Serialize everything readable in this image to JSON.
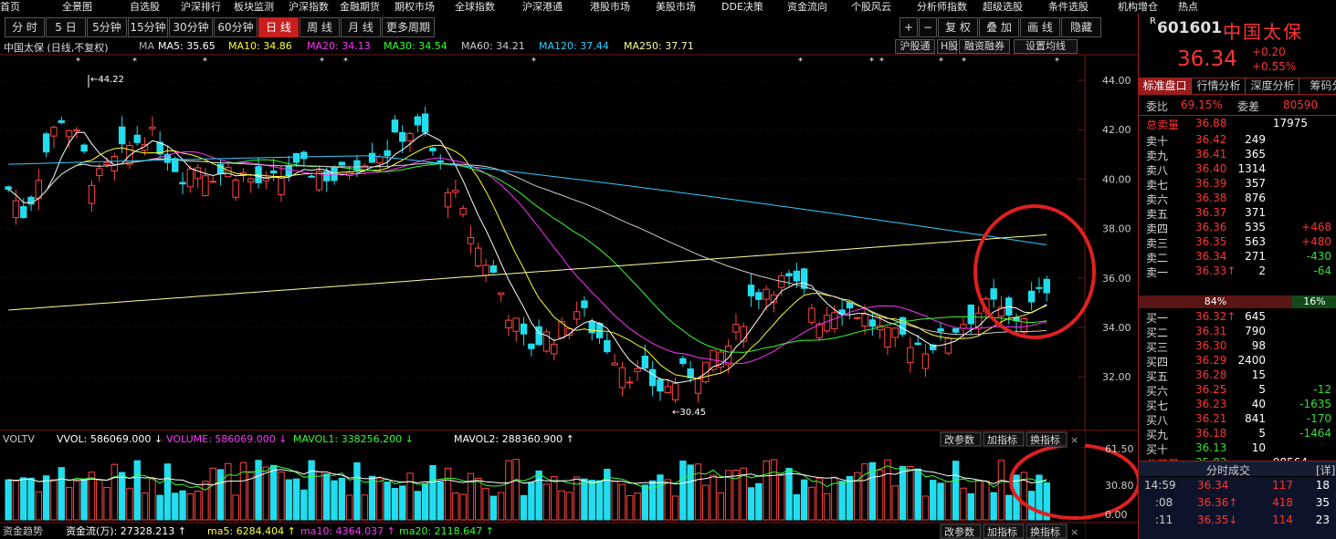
{
  "menu": [
    "首页",
    "全景图",
    "自选股",
    "沪深排行",
    "板块监测",
    "沪深指数",
    "金融期货",
    "期权市场",
    "全球指数",
    "沪深港通",
    "港股市场",
    "美股市场",
    "DDE决策",
    "资金流向",
    "个股风云",
    "分析师指数",
    "超级选股",
    "条件选股",
    "机构增仓",
    "热点"
  ],
  "toolbar": {
    "periods": [
      "分 时",
      "5 日",
      "5分钟",
      "15分钟",
      "30分钟",
      "60分钟",
      "日 线",
      "周 线",
      "月 线",
      "更多周期"
    ],
    "active_period": "日 线",
    "right_buttons": [
      "+",
      "−",
      "复 权",
      "叠 加",
      "画 线",
      "隐藏"
    ]
  },
  "main_legend": {
    "title": "中国太保 (日线,不复权)",
    "ma_label": "MA",
    "items": [
      {
        "label": "MA5: 35.65",
        "color": "#ffffff"
      },
      {
        "label": "MA10: 34.86",
        "color": "#ffff33"
      },
      {
        "label": "MA20: 34.13",
        "color": "#ff33ff"
      },
      {
        "label": "MA30: 34.54",
        "color": "#33ff33"
      },
      {
        "label": "MA60: 34.21",
        "color": "#cccccc"
      },
      {
        "label": "MA120: 37.44",
        "color": "#33ccff"
      },
      {
        "label": "MA250: 37.71",
        "color": "#ffff99"
      }
    ],
    "buttons": [
      "沪股通",
      "H股",
      "融资融券",
      "设置均线"
    ]
  },
  "price_axis": [
    "44.00",
    "42.00",
    "40.00",
    "38.00",
    "36.00",
    "34.00",
    "32.00"
  ],
  "annotations": {
    "high": "44.22",
    "low": "30.45"
  },
  "vol_legend": {
    "name": "VOLTV",
    "items": [
      {
        "label": "VVOL: 586069.000",
        "color": "#ffffff"
      },
      {
        "label": "VOLUME: 586069.000",
        "color": "#ff33ff"
      },
      {
        "label": "MAVOL1: 338256.200",
        "color": "#33ff33"
      },
      {
        "label": "MAVOL2: 288360.900",
        "color": "#ffffff"
      }
    ],
    "buttons": [
      "改参数",
      "加指标",
      "换指标"
    ],
    "axis": [
      "61.50",
      "30.80",
      "0.00"
    ]
  },
  "fund_legend": {
    "name": "资金趋势",
    "items": [
      {
        "label": "资金流(万): 27328.213",
        "color": "#ffffff"
      },
      {
        "label": "ma5: 6284.404",
        "color": "#ffff33"
      },
      {
        "label": "ma10: 4364.037",
        "color": "#ff33ff"
      },
      {
        "label": "ma20: 2118.647",
        "color": "#33ff33"
      }
    ],
    "buttons": [
      "改参数",
      "加指标",
      "换指标"
    ]
  },
  "stock": {
    "code": "601601",
    "name": "中国太保",
    "price": "36.34",
    "change": "+0.20",
    "change_pct": "+0.55%"
  },
  "rtabs": [
    "标准盘口",
    "行情分析",
    "深度分析",
    "筹码分"
  ],
  "weibi": {
    "label": "委比",
    "value": "69.15%",
    "diff_label": "委差",
    "diff": "80590"
  },
  "sell_total": {
    "label": "总卖量",
    "price": "36.88",
    "vol": "17975"
  },
  "asks": [
    {
      "label": "卖十",
      "price": "36.42",
      "vol": "249",
      "chg": ""
    },
    {
      "label": "卖九",
      "price": "36.41",
      "vol": "365",
      "chg": ""
    },
    {
      "label": "卖八",
      "price": "36.40",
      "vol": "1314",
      "chg": ""
    },
    {
      "label": "卖七",
      "price": "36.39",
      "vol": "357",
      "chg": ""
    },
    {
      "label": "卖六",
      "price": "36.38",
      "vol": "876",
      "chg": ""
    },
    {
      "label": "卖五",
      "price": "36.37",
      "vol": "371",
      "chg": ""
    },
    {
      "label": "卖四",
      "price": "36.36",
      "vol": "535",
      "chg": "+468"
    },
    {
      "label": "卖三",
      "price": "36.35",
      "vol": "563",
      "chg": "+480"
    },
    {
      "label": "卖二",
      "price": "36.34",
      "vol": "271",
      "chg": "-430"
    },
    {
      "label": "卖一",
      "price": "36.33↑",
      "vol": "2",
      "chg": "-64"
    }
  ],
  "ratio": {
    "left": "84%",
    "right": "16%"
  },
  "bids": [
    {
      "label": "买一",
      "price": "36.32↑",
      "vol": "645",
      "chg": ""
    },
    {
      "label": "买二",
      "price": "36.31",
      "vol": "790",
      "chg": ""
    },
    {
      "label": "买三",
      "price": "36.30",
      "vol": "98",
      "chg": ""
    },
    {
      "label": "买四",
      "price": "36.29",
      "vol": "2400",
      "chg": ""
    },
    {
      "label": "买五",
      "price": "36.28",
      "vol": "15",
      "chg": ""
    },
    {
      "label": "买六",
      "price": "36.25",
      "vol": "5",
      "chg": "-12"
    },
    {
      "label": "买七",
      "price": "36.23",
      "vol": "40",
      "chg": "-1635"
    },
    {
      "label": "买八",
      "price": "36.21",
      "vol": "841",
      "chg": "-170"
    },
    {
      "label": "买九",
      "price": "36.18",
      "vol": "5",
      "chg": "-1464"
    },
    {
      "label": "买十",
      "price": "36.13",
      "vol": "10",
      "chg": ""
    }
  ],
  "buy_total": {
    "label": "总买量",
    "price": "35.83",
    "vol": "98564"
  },
  "ticks_header": {
    "title": "分时成交",
    "detail": "[详]"
  },
  "ticks": [
    {
      "time": "14:59",
      "price": "36.34",
      "vol": "117",
      "n": "18"
    },
    {
      "time": ":08",
      "price": "36.36↑",
      "vol": "418",
      "n": "35"
    },
    {
      "time": ":11",
      "price": "36.35↓",
      "vol": "114",
      "n": "23"
    }
  ]
}
